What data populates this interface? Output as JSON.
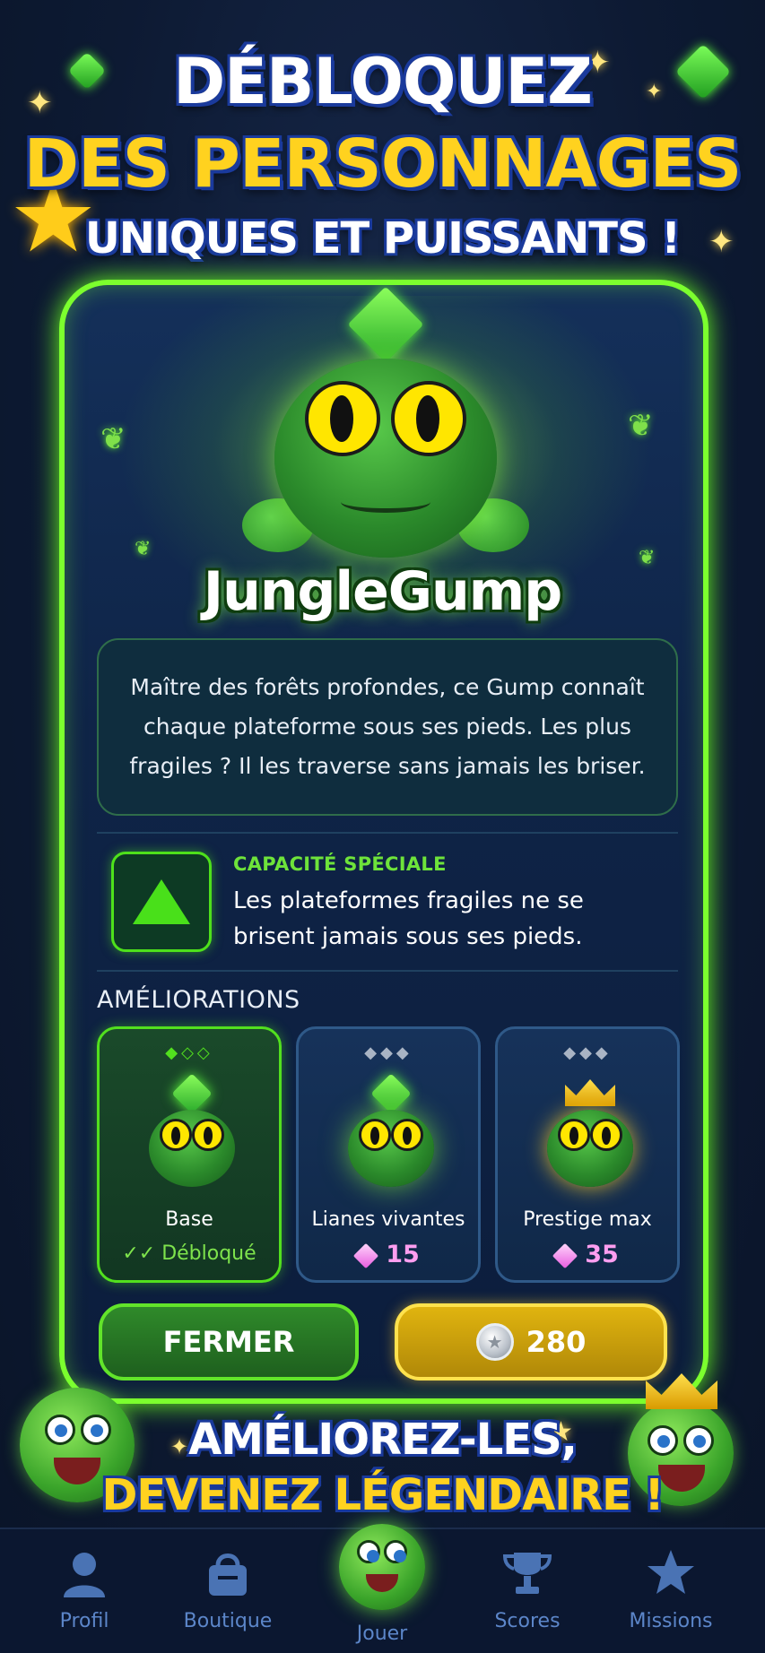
{
  "header": {
    "line1": "DÉBLOQUEZ",
    "line2": "DES PERSONNAGES",
    "line3": "UNIQUES ET PUISSANTS !"
  },
  "character": {
    "name": "JungleGump",
    "description": "Maître des forêts profondes, ce Gump connaît chaque plateforme sous ses pieds. Les plus fragiles ? Il les traverse sans jamais les briser.",
    "ability_label": "CAPACITÉ SPÉCIALE",
    "ability_text": "Les plateformes fragiles ne se brisent jamais sous ses pieds.",
    "ability_icon": "tree-icon"
  },
  "upgrades": {
    "title": "AMÉLIORATIONS",
    "items": [
      {
        "label": "Base",
        "status": "✓✓ Débloqué",
        "dots": "◆◇◇",
        "unlocked": true
      },
      {
        "label": "Lianes vivantes",
        "price": "15",
        "dots": "◆◆◆",
        "unlocked": false
      },
      {
        "label": "Prestige max",
        "price": "35",
        "dots": "◆◆◆",
        "unlocked": false
      }
    ]
  },
  "buttons": {
    "close_label": "FERMER",
    "buy_price": "280"
  },
  "promo": {
    "line1": "AMÉLIOREZ-LES,",
    "line2": "DEVENEZ LÉGENDAIRE !"
  },
  "nav": {
    "items": [
      {
        "label": "Profil",
        "icon": "profile-icon"
      },
      {
        "label": "Boutique",
        "icon": "shop-bag-icon"
      },
      {
        "label": "Jouer",
        "icon": "play-frog-icon"
      },
      {
        "label": "Scores",
        "icon": "trophy-icon"
      },
      {
        "label": "Missions",
        "icon": "star-icon"
      }
    ]
  },
  "colors": {
    "accent_green": "#7cff2e",
    "title_yellow": "#ffd21f",
    "outline_blue": "#1a3a9c",
    "nav_label": "#5c86c9",
    "gem_pink": "#ff9ef0"
  }
}
